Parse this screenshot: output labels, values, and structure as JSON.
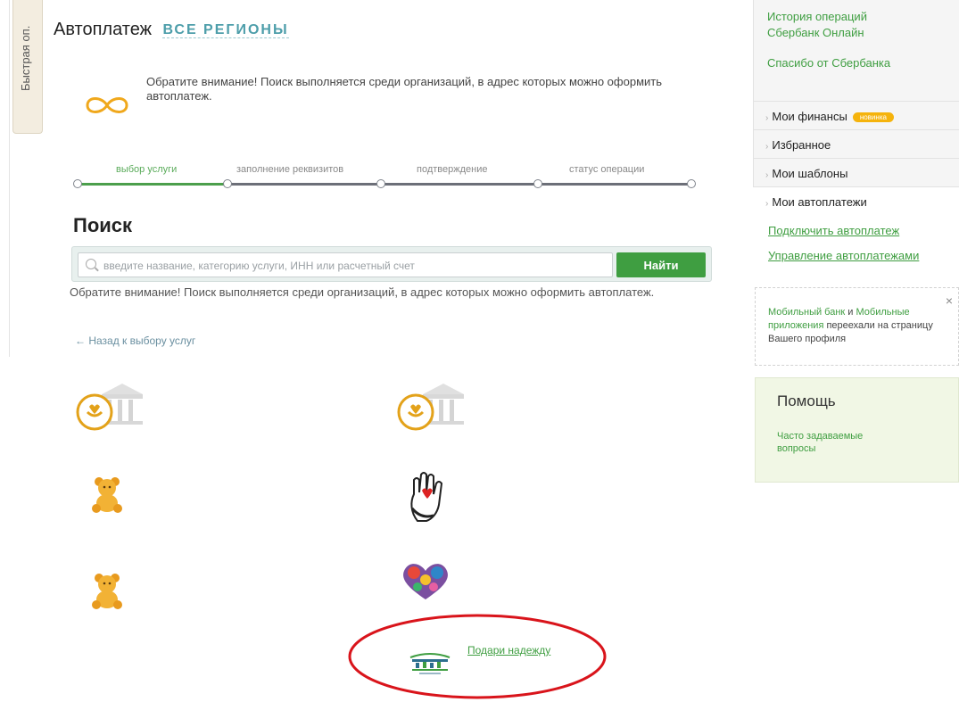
{
  "quick_tab": {
    "label": "Быстрая оп."
  },
  "header": {
    "title": "Автоплатеж",
    "regions": "ВСЕ РЕГИОНЫ"
  },
  "notice": {
    "text": "Обратите внимание! Поиск выполняется среди организаций, в адрес которых можно оформить автоплатеж."
  },
  "steps": [
    {
      "label": "выбор услуги",
      "active": true
    },
    {
      "label": "заполнение реквизитов",
      "active": false
    },
    {
      "label": "подтверждение",
      "active": false
    },
    {
      "label": "статус операции",
      "active": false
    }
  ],
  "search": {
    "title": "Поиск",
    "placeholder": "введите название, категорию услуги, ИНН или расчетный счет",
    "button": "Найти",
    "note": "Обратите внимание! Поиск выполняется среди организаций, в адрес которых можно оформить автоплатеж."
  },
  "back_link": "← Назад к выбору услуг",
  "results": {
    "highlighted_link": "Подари надежду"
  },
  "sidebar": {
    "links": [
      "История операций Сбербанк Онлайн",
      "Спасибо от Сбербанка"
    ],
    "menu": [
      {
        "label": "Мои финансы",
        "badge": "новинка"
      },
      {
        "label": "Избранное"
      },
      {
        "label": "Мои шаблоны"
      },
      {
        "label": "Мои автоплатежи"
      }
    ],
    "autopay_links": [
      "Подключить автоплатеж",
      "Управление автоплатежами"
    ],
    "info": {
      "link1": "Мобильный банк",
      "and": " и ",
      "link2": "Мобильные приложения",
      "rest": " переехали на страницу Вашего профиля",
      "close": "×"
    },
    "help": {
      "title": "Помощь",
      "faq": "Часто задаваемые вопросы"
    }
  },
  "colors": {
    "accent_green": "#3f9e41",
    "regions_blue": "#4d9eaa",
    "badge_orange": "#f5b30c",
    "annotation_red": "#d9141b"
  }
}
